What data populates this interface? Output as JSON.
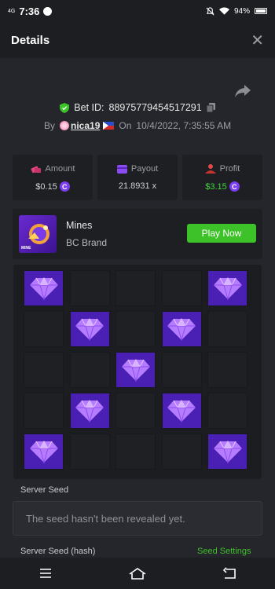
{
  "status_bar": {
    "network": "4G",
    "time": "7:36",
    "battery": "94%"
  },
  "header": {
    "title": "Details",
    "close_glyph": "✕"
  },
  "bet": {
    "id_label": "Bet ID:",
    "id_value": "88975779454517291",
    "by_label": "By",
    "username": "nica19",
    "on_label": "On",
    "datetime": "10/4/2022, 7:35:55 AM"
  },
  "stats": {
    "amount": {
      "label": "Amount",
      "value": "$0.15"
    },
    "payout": {
      "label": "Payout",
      "value": "21.8931 x"
    },
    "profit": {
      "label": "Profit",
      "value": "$3.15"
    }
  },
  "coin_glyph": "C",
  "game": {
    "name": "Mines",
    "brand": "BC Brand",
    "thumb_label": "MINE",
    "play_label": "Play Now"
  },
  "board": {
    "rows": 5,
    "cols": 5,
    "cells": [
      "gem",
      "empty",
      "empty",
      "empty",
      "gem",
      "empty",
      "gem",
      "empty",
      "gem",
      "empty",
      "empty",
      "empty",
      "gem",
      "empty",
      "empty",
      "empty",
      "gem",
      "empty",
      "gem",
      "empty",
      "gem",
      "empty",
      "empty",
      "empty",
      "gem"
    ]
  },
  "seeds": {
    "server_seed_label": "Server Seed",
    "server_seed_value": "The seed hasn't been revealed yet.",
    "server_seed_hash_label": "Server Seed (hash)",
    "seed_settings_label": "Seed Settings"
  },
  "colors": {
    "accent_green": "#3ec229",
    "gem_bg": "#4a1fb3",
    "coin": "#7b3df0",
    "profit_green": "#43d43e"
  }
}
